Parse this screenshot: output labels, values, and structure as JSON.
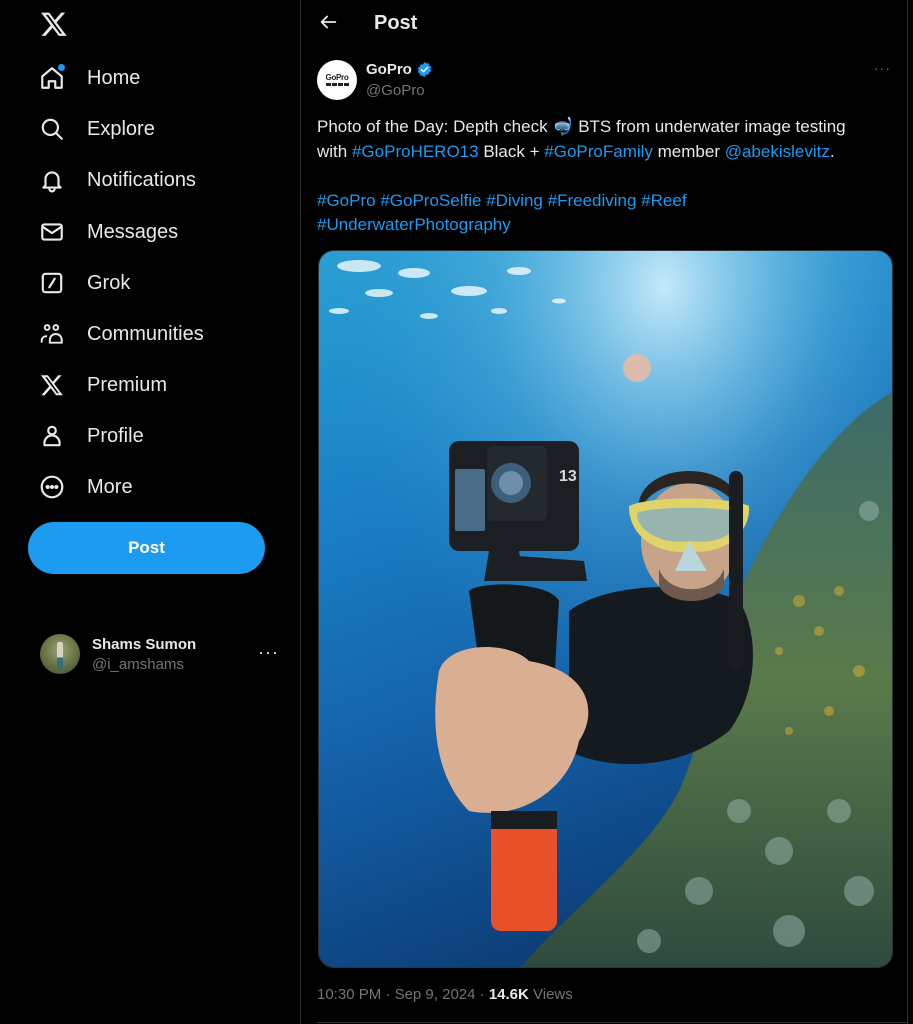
{
  "sidebar": {
    "logo": "x-logo-icon",
    "items": [
      {
        "label": "Home",
        "icon": "home-icon",
        "has_notification_dot": true
      },
      {
        "label": "Explore",
        "icon": "search-icon"
      },
      {
        "label": "Notifications",
        "icon": "bell-icon"
      },
      {
        "label": "Messages",
        "icon": "envelope-icon"
      },
      {
        "label": "Grok",
        "icon": "grok-icon"
      },
      {
        "label": "Communities",
        "icon": "communities-icon"
      },
      {
        "label": "Premium",
        "icon": "x-premium-icon"
      },
      {
        "label": "Profile",
        "icon": "person-icon"
      },
      {
        "label": "More",
        "icon": "more-circle-icon"
      }
    ],
    "post_button_label": "Post",
    "account": {
      "name": "Shams Sumon",
      "handle": "@i_amshams",
      "more": "···"
    }
  },
  "header": {
    "back_icon": "arrow-left-icon",
    "title": "Post"
  },
  "post": {
    "author": {
      "name": "GoPro",
      "handle": "@GoPro",
      "verified": true,
      "avatar_text": "GoPro"
    },
    "more": "···",
    "text": {
      "line1_a": "Photo of the Day: Depth check ",
      "emoji": "🤿",
      "line1_b": " BTS from underwater image testing",
      "with": "with ",
      "tag_hero13": "#GoProHERO13",
      "black_plus": " Black + ",
      "tag_family": "#GoProFamily",
      "member": " member ",
      "mention": "@abekislevitz",
      "period": ".",
      "hashtags": [
        "#GoPro",
        "#GoProSelfie",
        "#Diving",
        "#Freediving",
        "#Reef",
        "#UnderwaterPhotography"
      ]
    },
    "image_alt": "Underwater selfie of a freediver holding a GoPro HERO13 Black on a grip above a coral reef",
    "camera_label": "13",
    "time": "10:30 PM",
    "date": "Sep 9, 2024",
    "separator": " · ",
    "views_count": "14.6K",
    "views_label": "Views"
  },
  "colors": {
    "accent": "#1d9bf0",
    "background": "#000000",
    "text": "#e7e9ea",
    "muted": "#71767b",
    "border": "#2f3336"
  }
}
